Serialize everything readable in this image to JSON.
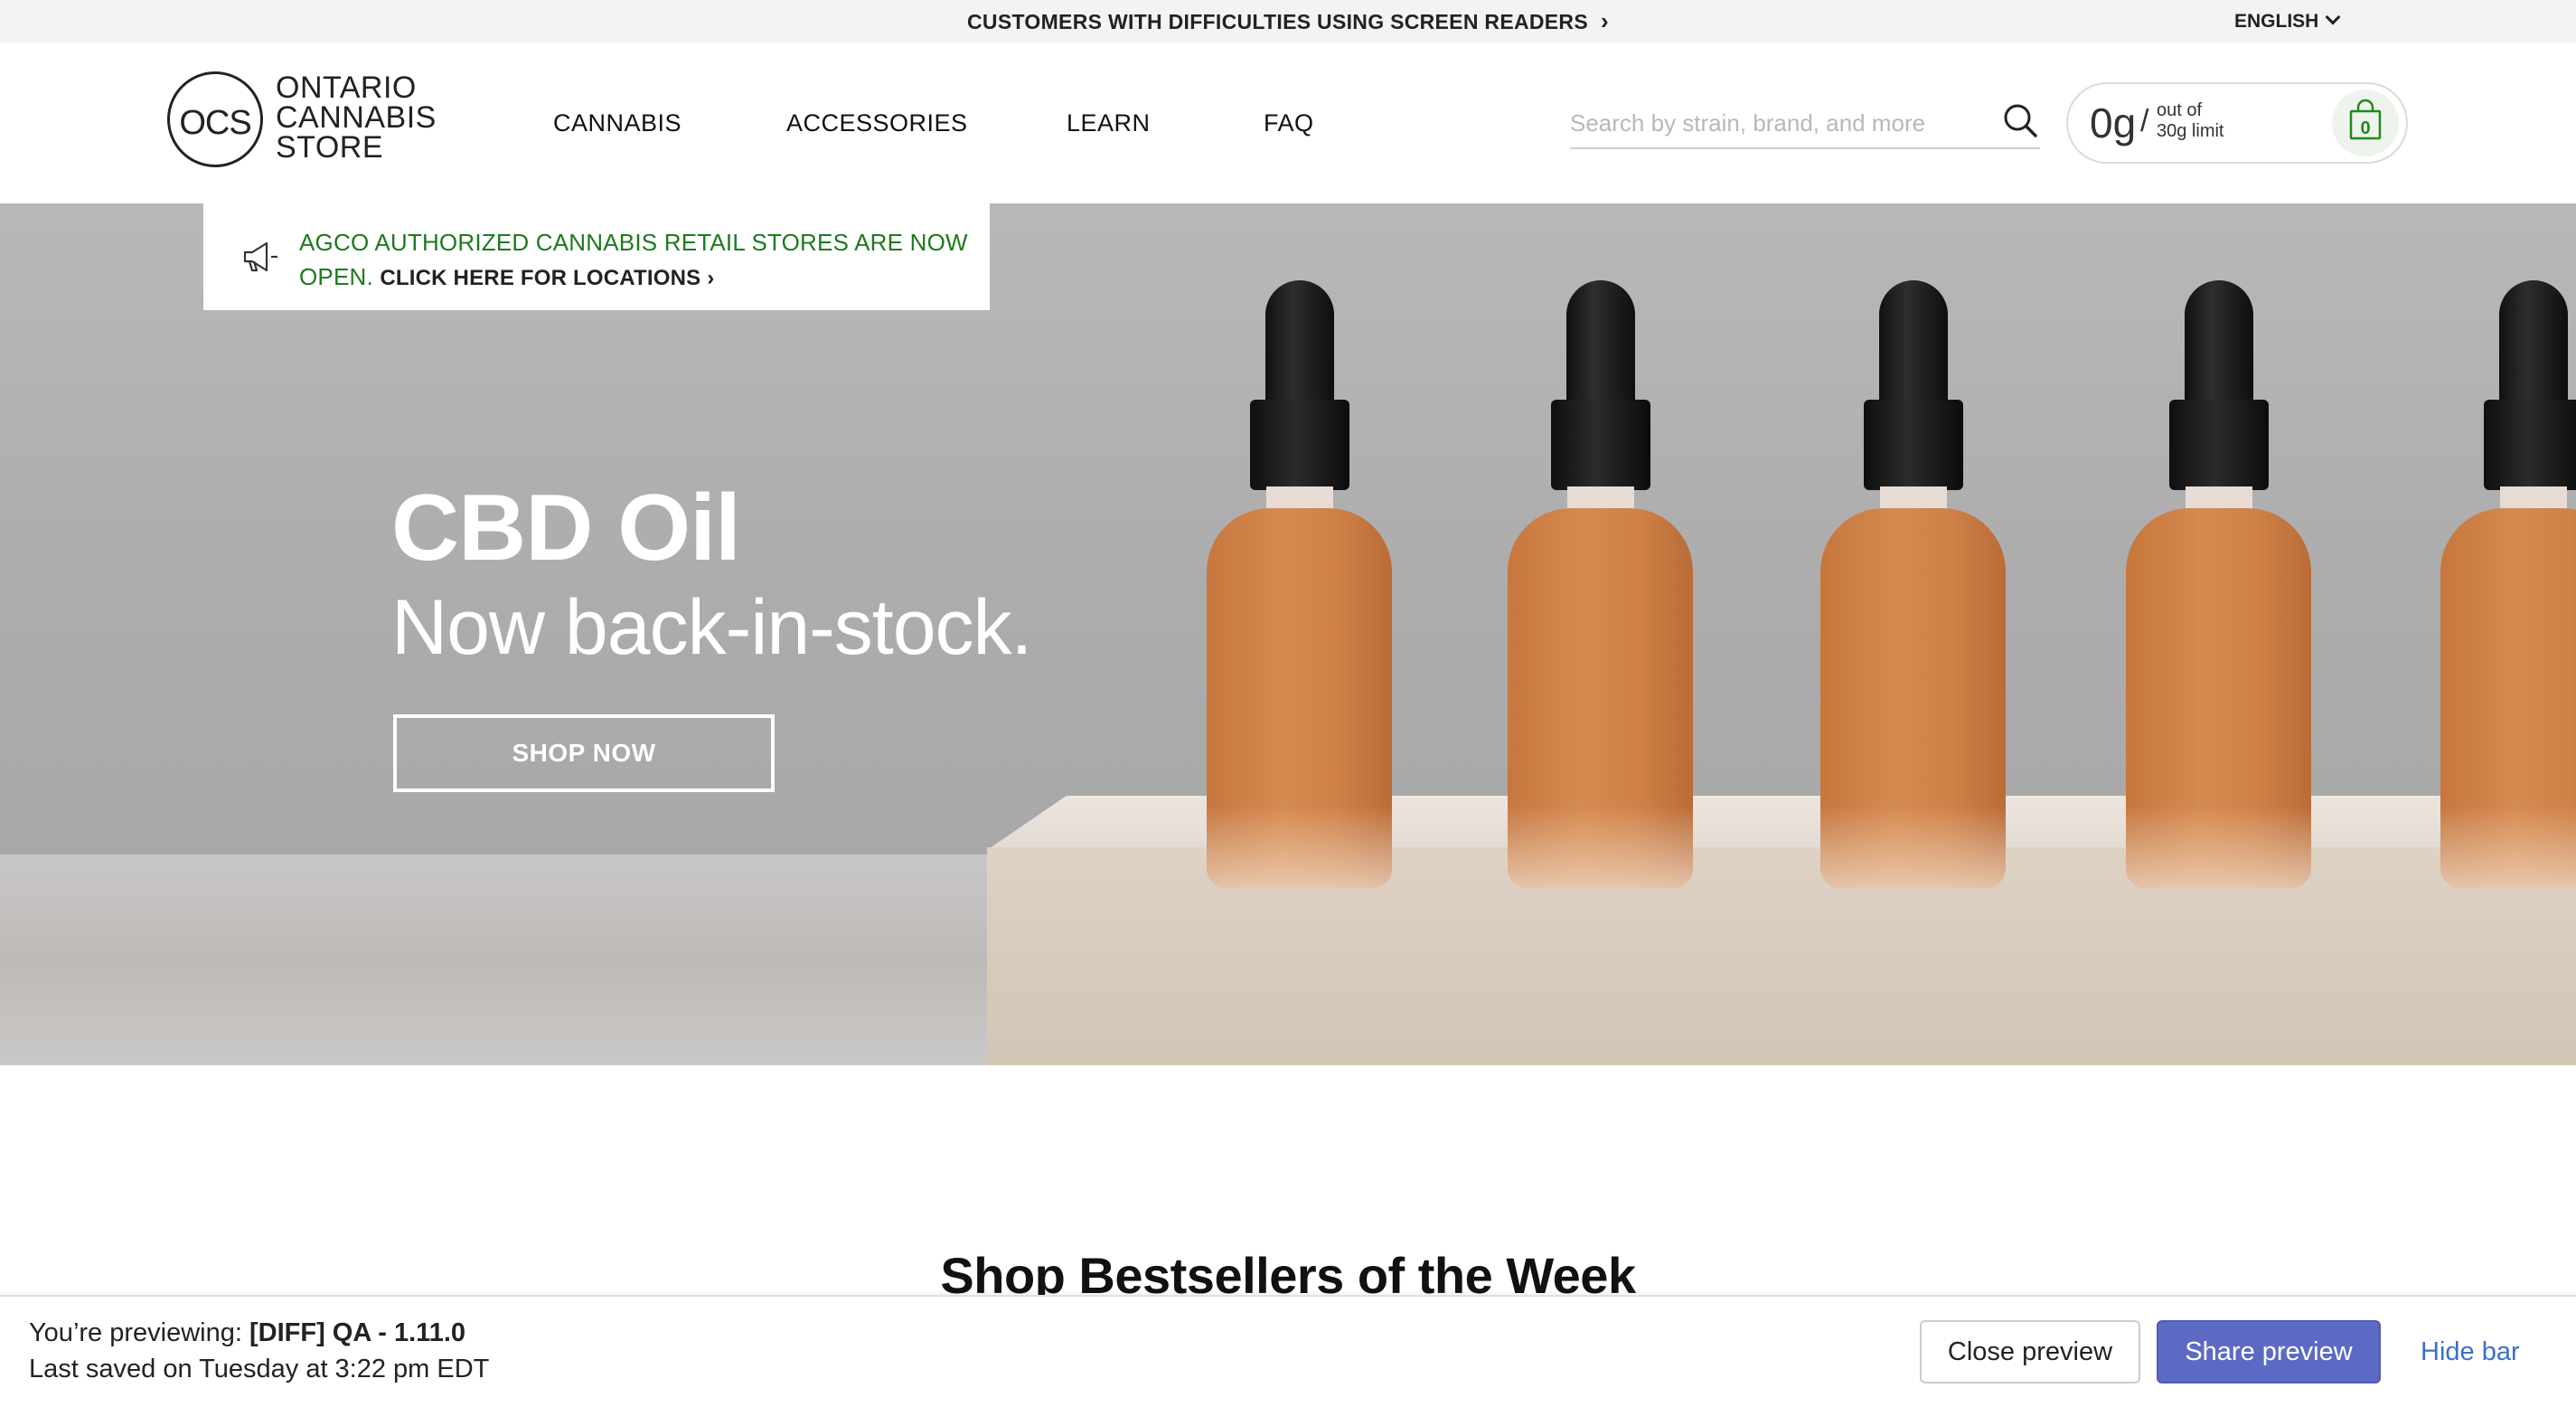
{
  "topbar": {
    "a11y_text": "CUSTOMERS WITH DIFFICULTIES USING SCREEN READERS",
    "a11y_chevron": "›",
    "language": "ENGLISH"
  },
  "logo": {
    "mark": "OCS",
    "line1": "ONTARIO",
    "line2": "CANNABIS",
    "line3": "STORE"
  },
  "nav": {
    "items": [
      "CANNABIS",
      "ACCESSORIES",
      "LEARN",
      "FAQ"
    ]
  },
  "search": {
    "placeholder": "Search by strain, brand, and more",
    "icon": "search-icon"
  },
  "limit": {
    "amount": "0g",
    "slash": "/",
    "out_of": "out of",
    "limit": "30g limit",
    "bag_count": "0",
    "bag_icon": "shopping-bag-icon"
  },
  "notice": {
    "icon": "megaphone-icon",
    "text": "AGCO AUTHORIZED CANNABIS RETAIL STORES ARE NOW OPEN.",
    "link": "CLICK HERE FOR LOCATIONS",
    "link_chevron": "›"
  },
  "hero": {
    "title": "CBD Oil",
    "subtitle": "Now back-in-stock.",
    "cta": "SHOP NOW"
  },
  "section": {
    "title": "Shop Bestsellers of the Week"
  },
  "preview": {
    "label": "You’re previewing:",
    "theme": "[DIFF] QA - 1.11.0",
    "saved": "Last saved on Tuesday at 3:22 pm EDT",
    "close": "Close preview",
    "share": "Share preview",
    "hide": "Hide bar"
  },
  "colors": {
    "notice_green": "#1d7a1d",
    "share_button": "#5c6ac4",
    "hide_link": "#3c70c8"
  }
}
